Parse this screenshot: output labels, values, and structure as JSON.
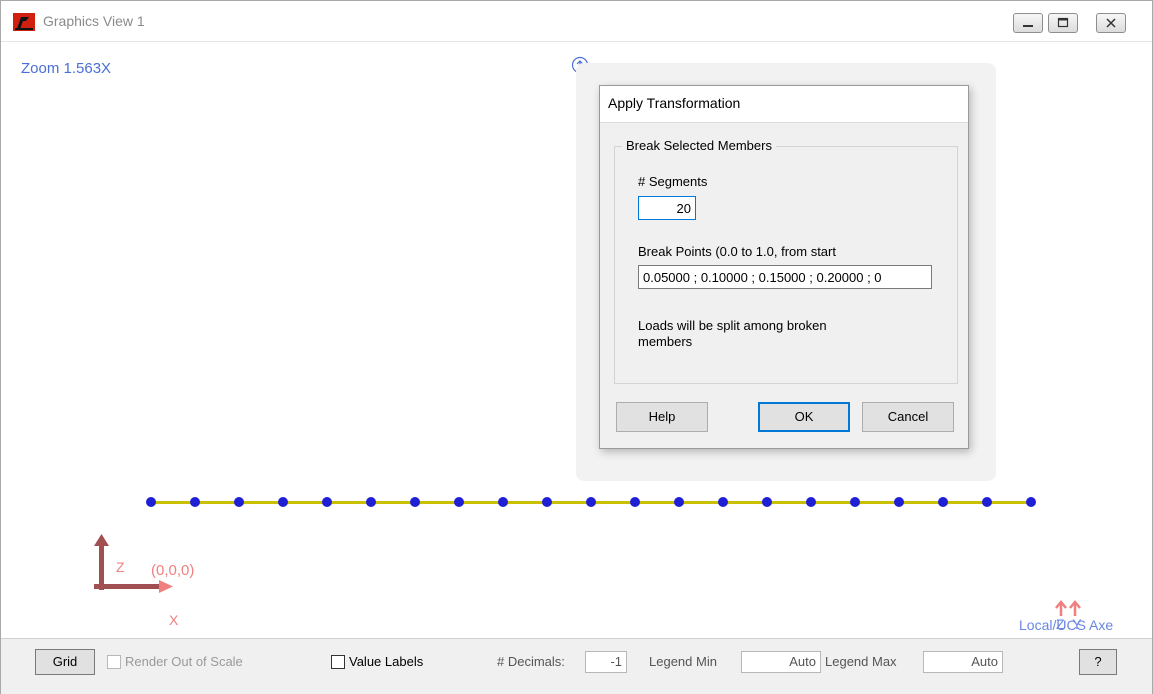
{
  "window": {
    "title": "Graphics View 1"
  },
  "canvas": {
    "zoom_label": "Zoom  1.563X",
    "origin_label": "(0,0,0)",
    "axis_z": "Z",
    "axis_x": "X",
    "local_zy": "Z Y",
    "local_axes_label": "Local/UCS Axe",
    "node_count": 21
  },
  "dialog": {
    "title": "Apply Transformation",
    "group_title": "Break Selected Members",
    "segments_label": "# Segments",
    "segments_value": "20",
    "breakpoints_label": "Break Points (0.0 to 1.0, from start",
    "breakpoints_value": "0.05000 ; 0.10000 ; 0.15000 ; 0.20000 ; 0",
    "note": "Loads will be split among broken members",
    "help_label": "Help",
    "ok_label": "OK",
    "cancel_label": "Cancel"
  },
  "statusbar": {
    "grid_label": "Grid",
    "render_label": "Render Out of Scale",
    "value_labels_label": "Value Labels",
    "decimals_label": "# Decimals:",
    "decimals_value": "-1",
    "legend_min_label": "Legend Min",
    "legend_min_value": "Auto",
    "legend_max_label": "Legend Max",
    "legend_max_value": "Auto",
    "help_label": "?"
  },
  "colors": {
    "member": "#c8c000",
    "node": "#1f1fd6",
    "axis": "#a05050",
    "accent": "#0078d7"
  }
}
